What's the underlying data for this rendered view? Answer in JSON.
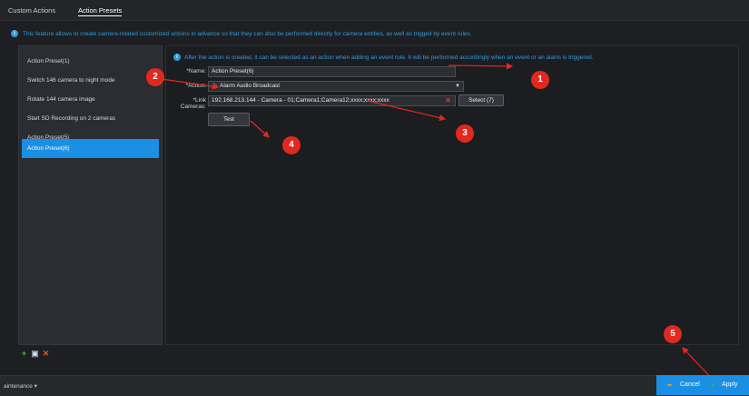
{
  "tabs": {
    "custom_actions": "Custom Actions",
    "action_presets": "Action Presets"
  },
  "info_text": "This feature allows to create camera-related customized actions in advance so that they can also be performed directly for camera entities, as well as trigged by event rules.",
  "presets": [
    "Action Preset(1)",
    "Switch 146 camera to night mode",
    "Rotate 144 camera image",
    "Start SD Recording on 2 cameras",
    "Action Preset(5)",
    "Action Preset(6)"
  ],
  "selected_preset_index": 5,
  "hint_text": "After the action is created, it can be selected as an action when adding an event rule. It will be performed accordingly when an event or an alarm is triggered.",
  "form": {
    "name_label": "*Name:",
    "name_value": "Action Preset(6)",
    "action_label": "*Action:",
    "action_value": "Alarm Audio Broadcast",
    "cameras_label": "*Link Cameras:",
    "cameras_value": "192.168.213.144 - Camera - 01;Camera1;Camera12;xxxx;xxxx;xxxx",
    "select_button": "Select (7)",
    "test_button": "Test"
  },
  "badges": [
    "1",
    "2",
    "3",
    "4",
    "5"
  ],
  "bottom": {
    "maintenance": "aintenance",
    "cancel": "Cancel",
    "apply": "Apply"
  },
  "colors": {
    "accent": "#1a8fe3",
    "badge": "#e0291f",
    "info": "#2f9be0"
  }
}
